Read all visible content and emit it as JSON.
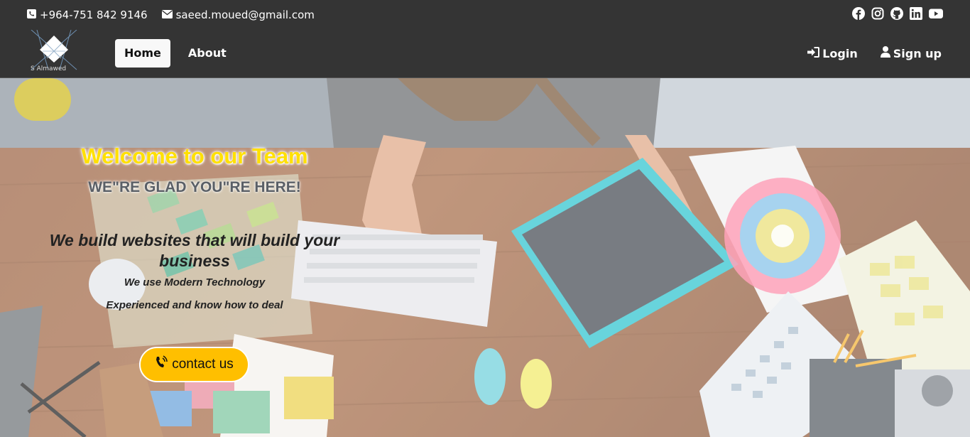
{
  "topbar": {
    "phone": "+964-751 842 9146",
    "email": "saeed.moued@gmail.com",
    "phone_icon": "phone-square-icon",
    "email_icon": "envelope-icon",
    "social": [
      "facebook-icon",
      "instagram-icon",
      "github-icon",
      "linkedin-icon",
      "youtube-icon"
    ]
  },
  "navbar": {
    "logo_text": "S Almawed",
    "links": [
      {
        "label": "Home",
        "active": true
      },
      {
        "label": "About",
        "active": false
      }
    ],
    "login_label": "Login",
    "signup_label": "Sign up"
  },
  "hero": {
    "welcome": "Welcome to our Team",
    "glad": "WE\"RE GLAD YOU\"RE HERE!",
    "build": "We build websites that will build your business",
    "tech": "We use Modern Technology",
    "experience": "Experienced and know how to deal",
    "cta_label": "contact us"
  },
  "colors": {
    "bar_bg": "#343434",
    "accent_yellow": "#ffbf00",
    "welcome_yellow": "#ffe000"
  }
}
